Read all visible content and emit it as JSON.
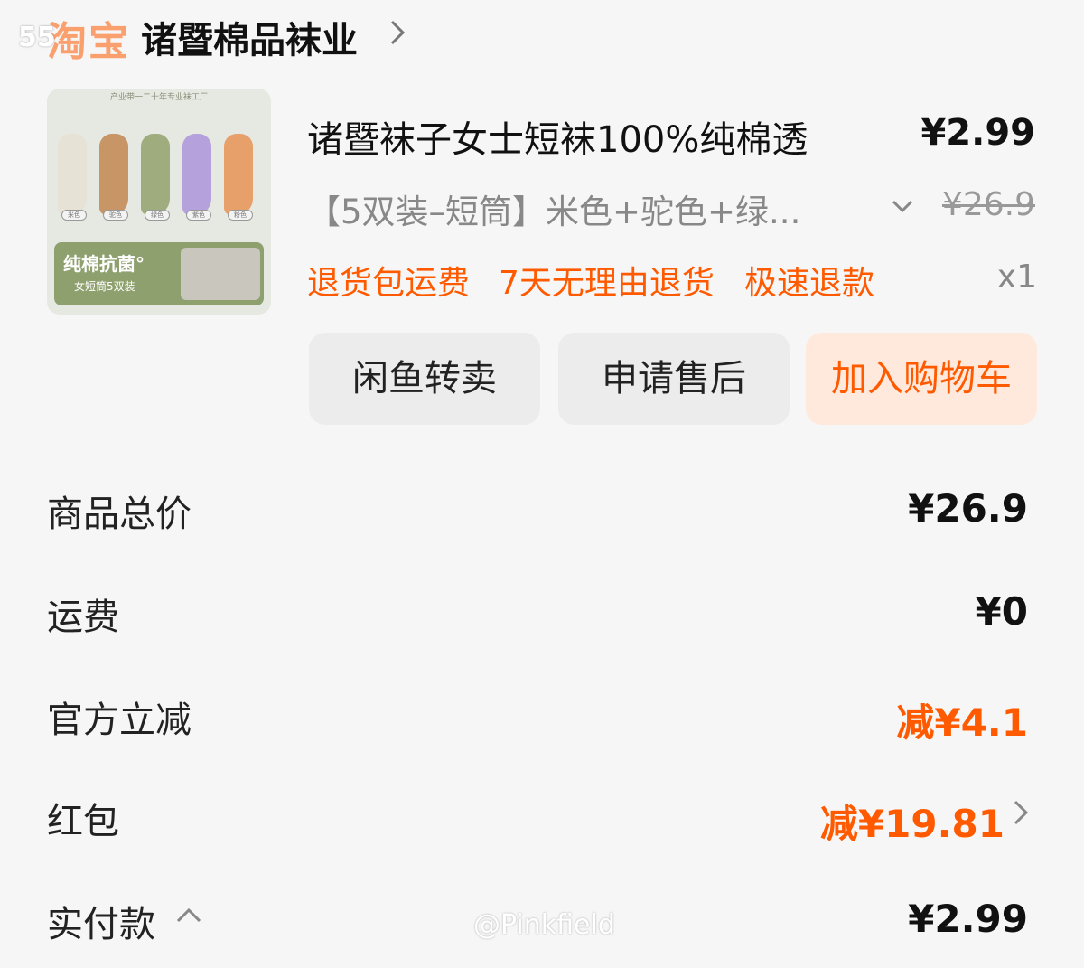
{
  "header": {
    "brand": "淘宝",
    "status_overlay": "55",
    "shop_name": "诸暨棉品袜业"
  },
  "product": {
    "thumbnail": {
      "top_line": "产业带一二十年专业袜工厂",
      "banner_title": "纯棉抗菌°",
      "banner_subtitle": "女短筒5双装",
      "sock_tags": [
        "米色",
        "驼色",
        "绿色",
        "紫色",
        "粉色"
      ],
      "sock_colors": [
        "#e7e2d6",
        "#c79566",
        "#9eac7e",
        "#b5a1dc",
        "#e8a06a"
      ]
    },
    "title": "诸暨袜子女士短袜100%纯棉透",
    "price": "¥2.99",
    "spec": "【5双装–短筒】米色+驼色+绿...",
    "original_price": "¥26.9",
    "tags": [
      "退货包运费",
      "7天无理由退货",
      "极速退款"
    ],
    "quantity": "x1"
  },
  "actions": {
    "resell_label": "闲鱼转卖",
    "after_sale_label": "申请售后",
    "add_cart_label": "加入购物车"
  },
  "summary": {
    "rows": [
      {
        "label": "商品总价",
        "value": "¥26.9"
      },
      {
        "label": "运费",
        "value": "¥0"
      },
      {
        "label": "官方立减",
        "value": "减¥4.1"
      },
      {
        "label": "红包",
        "value": "减¥19.81"
      },
      {
        "label": "实付款",
        "value": "¥2.99"
      }
    ]
  },
  "watermark": "@Pinkfield",
  "colors": {
    "accent": "#ff5a00",
    "button_bg": "#ececec",
    "primary_button_bg": "#ffe8dc"
  }
}
